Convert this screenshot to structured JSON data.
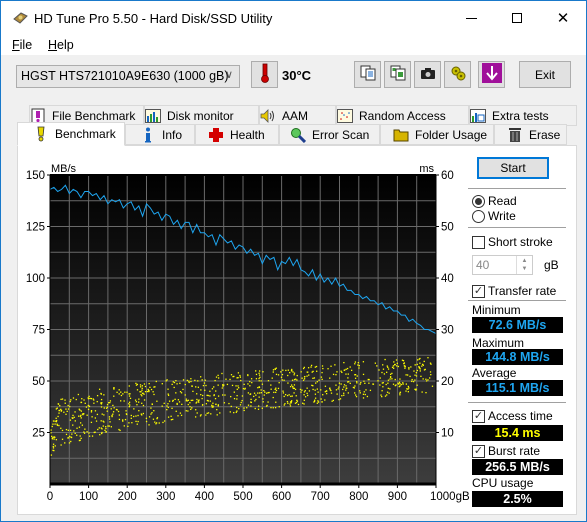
{
  "window": {
    "title": "HD Tune Pro 5.50 - Hard Disk/SSD Utility",
    "controls": {
      "minimize": "—",
      "maximize": "☐",
      "close": "✕"
    }
  },
  "menu": {
    "items": [
      {
        "label_first": "F",
        "label_rest": "ile"
      },
      {
        "label_first": "H",
        "label_rest": "elp"
      }
    ]
  },
  "toolbar": {
    "drive": "HGST HTS721010A9E630 (1000 gB)",
    "temperature": "30°C",
    "icons": [
      "copy-text-icon",
      "copy-screenshot-icon",
      "camera-icon",
      "options-icon",
      "save-download-icon"
    ],
    "exit_label": "Exit"
  },
  "tabs": {
    "row1": [
      {
        "label": "File Benchmark",
        "icon": "file-benchmark-icon"
      },
      {
        "label": "Disk monitor",
        "icon": "disk-monitor-icon"
      },
      {
        "label": "AAM",
        "icon": "speaker-icon"
      },
      {
        "label": "Random Access",
        "icon": "random-access-icon"
      },
      {
        "label": "Extra tests",
        "icon": "extra-tests-icon"
      }
    ],
    "row2": [
      {
        "label": "Benchmark",
        "icon": "benchmark-icon",
        "active": true
      },
      {
        "label": "Info",
        "icon": "info-icon"
      },
      {
        "label": "Health",
        "icon": "health-icon"
      },
      {
        "label": "Error Scan",
        "icon": "magnifier-icon"
      },
      {
        "label": "Folder Usage",
        "icon": "folder-icon"
      },
      {
        "label": "Erase",
        "icon": "trash-icon"
      }
    ]
  },
  "side": {
    "start_label": "Start",
    "read_label": "Read",
    "write_label": "Write",
    "mode_selected": "Read",
    "short_stroke_label": "Short stroke",
    "short_stroke_checked": false,
    "short_stroke_value": "40",
    "short_stroke_unit": "gB",
    "transfer_rate_label": "Transfer rate",
    "transfer_rate_checked": true,
    "minimum_label": "Minimum",
    "minimum_value": "72.6 MB/s",
    "maximum_label": "Maximum",
    "maximum_value": "144.8 MB/s",
    "average_label": "Average",
    "average_value": "115.1 MB/s",
    "access_time_label": "Access time",
    "access_time_checked": true,
    "access_time_value": "15.4 ms",
    "burst_rate_label": "Burst rate",
    "burst_rate_checked": true,
    "burst_rate_value": "256.5 MB/s",
    "cpu_label": "CPU usage",
    "cpu_value": "2.5%"
  },
  "chart_data": {
    "type": "line",
    "title": "",
    "ylabel_left": "MB/s",
    "ylabel_right": "ms",
    "xlabel": "gB",
    "x_ticks": [
      "0",
      "100",
      "200",
      "300",
      "400",
      "500",
      "600",
      "700",
      "800",
      "900",
      "1000gB"
    ],
    "y_left_ticks": [
      "150",
      "125",
      "100",
      "75",
      "50",
      "25"
    ],
    "y_right_ticks": [
      "60",
      "50",
      "40",
      "30",
      "20",
      "10"
    ],
    "xlim": [
      0,
      1000
    ],
    "ylim_left": [
      0,
      150
    ],
    "ylim_right": [
      0,
      60
    ],
    "grid": true,
    "series": [
      {
        "name": "Transfer rate",
        "axis": "left",
        "color": "#1ea5f0",
        "x": [
          0,
          10,
          20,
          30,
          40,
          50,
          60,
          70,
          80,
          90,
          100,
          110,
          120,
          130,
          140,
          150,
          160,
          170,
          180,
          190,
          200,
          210,
          220,
          230,
          240,
          250,
          260,
          270,
          280,
          290,
          300,
          310,
          320,
          330,
          340,
          350,
          360,
          370,
          380,
          390,
          400,
          410,
          420,
          430,
          440,
          450,
          460,
          470,
          480,
          490,
          500,
          510,
          520,
          530,
          540,
          550,
          560,
          570,
          580,
          590,
          600,
          610,
          620,
          630,
          640,
          650,
          660,
          670,
          680,
          690,
          700,
          710,
          720,
          730,
          740,
          750,
          760,
          770,
          780,
          790,
          800,
          810,
          820,
          830,
          840,
          850,
          860,
          870,
          880,
          890,
          900,
          910,
          920,
          930,
          940,
          950,
          960,
          970,
          980,
          990,
          1000
        ],
        "values": [
          143,
          144,
          142,
          143,
          145,
          141,
          143,
          142,
          139,
          142,
          142,
          140,
          141,
          138,
          140,
          136,
          138,
          137,
          138,
          134,
          136,
          137,
          133,
          135,
          130,
          136,
          134,
          131,
          132,
          128,
          131,
          130,
          126,
          128,
          124,
          127,
          127,
          122,
          126,
          122,
          122,
          120,
          121,
          116,
          121,
          119,
          117,
          118,
          114,
          116,
          115,
          112,
          114,
          111,
          112,
          107,
          111,
          109,
          110,
          104,
          108,
          107,
          110,
          106,
          109,
          104,
          103,
          101,
          104,
          99,
          102,
          98,
          100,
          97,
          100,
          96,
          97,
          94,
          94,
          92,
          92,
          90,
          91,
          89,
          89,
          87,
          88,
          85,
          86,
          84,
          84,
          82,
          82,
          79,
          80,
          78,
          77,
          75,
          75,
          74,
          73
        ]
      },
      {
        "name": "Access time",
        "axis": "right",
        "color": "#ffff00",
        "kind": "scatter",
        "trend_ms": {
          "start_low": 5,
          "start_high": 15,
          "end_low": 18,
          "end_high": 25
        },
        "average_ms": 15.4
      }
    ]
  }
}
